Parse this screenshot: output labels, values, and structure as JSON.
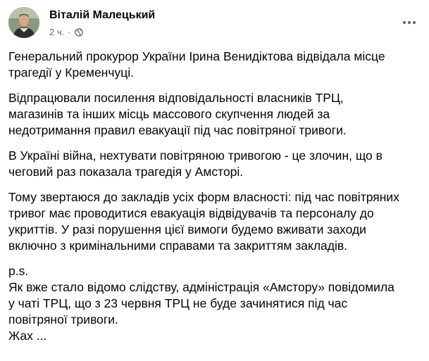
{
  "post": {
    "author": "Віталій Малецький",
    "time": "2 ч.",
    "separator": "·",
    "audience_icon": "globe-icon",
    "more_icon": "more-options-icon",
    "paragraphs": [
      "Генеральний прокурор України Ірина Венидіктова відвідала місце\nтрагедії у Кременчуці.",
      "Відпрацювали посилення відповідальності власників ТРЦ,\nмагазинів та інших місць массового скупчення людей за\nнедотримання правил евакуації під час повітряної тривоги.",
      "В Україні війна, нехтувати повітряною тривогою - це злочин, що в\nчеговий раз показала трагедія у Амсторі.",
      "Тому звертаюся до закладів усіх форм власності: під час повітряних\nтривог  має проводитися евакуація відвідувачів та персоналу до\nукриттів. У разі порушення цієї вимоги будемо вживати заходи\nвключно з кримінальними справами та закриттям закладів.",
      "p.s.\nЯк вже стало відомо слідству, адміністрація «Амстору» повідомила\nу чаті ТРЦ, що з 23 червня ТРЦ не буде зачинятися під час\nповітряної тривоги.\nЖах ..."
    ]
  },
  "colors": {
    "text": "#050505",
    "secondary_text": "#65676b",
    "background": "#ffffff"
  }
}
